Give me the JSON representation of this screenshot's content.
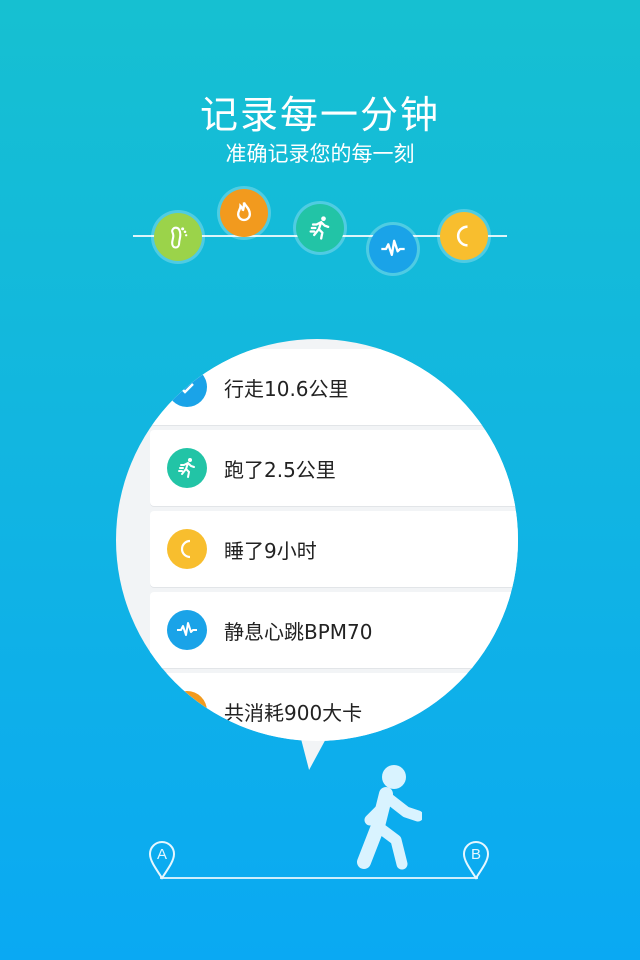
{
  "header": {
    "title": "记录每一分钟",
    "subtitle": "准确记录您的每一刻"
  },
  "timeline": {
    "icons": [
      "footprint-icon",
      "flame-icon",
      "running-icon",
      "heartbeat-icon",
      "moon-icon"
    ]
  },
  "records": [
    {
      "icon": "footprint-icon",
      "text": "行走10.6公里"
    },
    {
      "icon": "running-icon",
      "text": "跑了2.5公里"
    },
    {
      "icon": "moon-icon",
      "text": "睡了9小时"
    },
    {
      "icon": "heartbeat-icon",
      "text": "静息心跳BPM70"
    },
    {
      "icon": "flame-icon",
      "text": "共消耗900大卡"
    }
  ],
  "route": {
    "start_label": "A",
    "end_label": "B"
  },
  "colors": {
    "green": "#9bd34a",
    "orange": "#f29a1e",
    "teal": "#22c4a6",
    "blue": "#1aa3e8",
    "yellow": "#f8be2e"
  }
}
